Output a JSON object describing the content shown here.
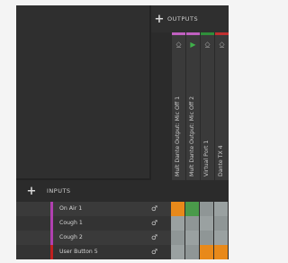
{
  "outputs": {
    "header_label": "OUTPUTS",
    "columns": [
      {
        "label": "Mult Dante Output: Mic Off 1",
        "color": "#c060c0",
        "icon": "headphones-icon",
        "glyph": "⎐"
      },
      {
        "label": "Mult Dante Output: Mic Off 2",
        "color": "#c060c0",
        "icon": "speaker-icon",
        "glyph": "▶"
      },
      {
        "label": "Virtual Port 1",
        "color": "#2f8f3a",
        "icon": "headphones-icon",
        "glyph": "⎐"
      },
      {
        "label": "Dante TX 4",
        "color": "#c03030",
        "icon": "headphones-icon",
        "glyph": "⎐"
      }
    ]
  },
  "inputs": {
    "header_label": "INPUTS",
    "rows": [
      {
        "label": "On Air 1",
        "color": "#b040b0",
        "icon": "microphone-icon"
      },
      {
        "label": "Cough 1",
        "color": "#b040b0",
        "icon": "microphone-icon"
      },
      {
        "label": "Cough 2",
        "color": "#b040b0",
        "icon": "microphone-icon"
      },
      {
        "label": "User Button 5",
        "color": "#c02020",
        "icon": "microphone-icon"
      }
    ]
  },
  "matrix": [
    [
      "on-orange",
      "on-green",
      "off",
      "off"
    ],
    [
      "off",
      "off",
      "off",
      "off"
    ],
    [
      "off",
      "off",
      "off",
      "off"
    ],
    [
      "off",
      "off",
      "on-orange",
      "on-orange"
    ]
  ],
  "colors": {
    "on-orange": "#e8891a",
    "on-green": "#4a9a4a",
    "off": "#8f9696",
    "off_alt": "#9aa1a1"
  }
}
